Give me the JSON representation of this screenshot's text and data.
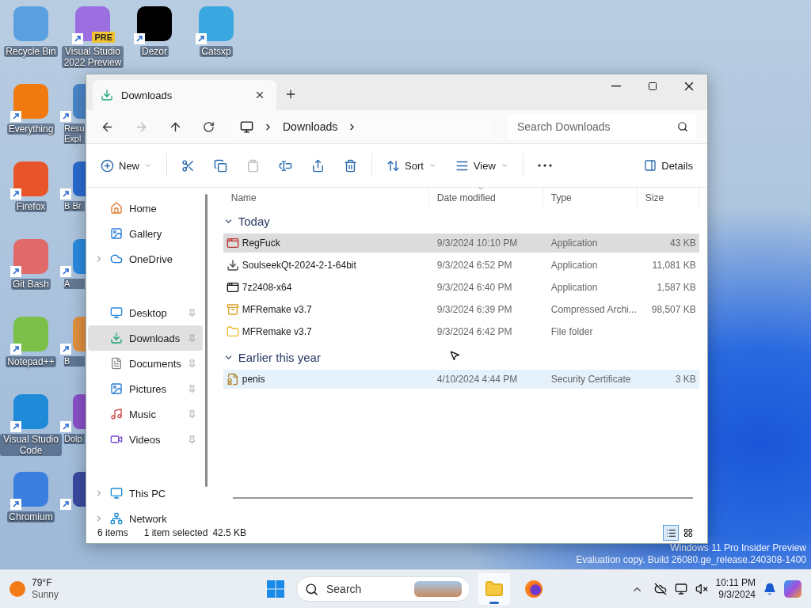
{
  "desktop": {
    "columns": [
      [
        {
          "label": "Recycle Bin",
          "kind": "full",
          "shortcut": false,
          "color": "#5aa0e0"
        },
        {
          "label": "Everything",
          "kind": "full",
          "shortcut": true,
          "color": "#f07a10"
        },
        {
          "label": "Firefox",
          "kind": "full",
          "shortcut": true,
          "color": "#e8552a"
        },
        {
          "label": "Git Bash",
          "kind": "full",
          "shortcut": true,
          "color": "#e06a6a"
        },
        {
          "label": "Notepad++",
          "kind": "full",
          "shortcut": true,
          "color": "#7cc04a"
        },
        {
          "label": "Visual Studio Code",
          "kind": "full",
          "shortcut": true,
          "color": "#1f8ad8"
        },
        {
          "label": "Chromium",
          "kind": "full",
          "shortcut": true,
          "color": "#3a7ee0"
        }
      ],
      [
        {
          "label": "Visual Studio 2022 Preview",
          "kind": "full",
          "shortcut": true,
          "color": "#9b6fe0",
          "badge": "PRE"
        },
        {
          "label": "Resu Expl",
          "kind": "partial",
          "shortcut": true,
          "color": "#4a86c8"
        },
        {
          "label": "B Br",
          "kind": "partial",
          "shortcut": true,
          "color": "#2a6ad0"
        },
        {
          "label": "A",
          "kind": "partial",
          "shortcut": true,
          "color": "#2a8ae0"
        },
        {
          "label": "B",
          "kind": "partial",
          "shortcut": true,
          "color": "#e09040"
        },
        {
          "label": "Dolp",
          "kind": "partial",
          "shortcut": true,
          "color": "#8a50c8"
        },
        {
          "kind": "partial",
          "shortcut": true,
          "color": "#3a4aa0"
        }
      ],
      [
        {
          "label": "Dezor",
          "kind": "full",
          "shortcut": true,
          "color": "#000000"
        }
      ],
      [
        {
          "label": "Catsxp",
          "kind": "full",
          "shortcut": true,
          "color": "#3aa8e0"
        }
      ]
    ]
  },
  "watermark": [
    "Windows 11 Pro Insider Preview",
    "Evaluation copy. Build 26080.ge_release.240308-1400"
  ],
  "window": {
    "tabs": [
      {
        "label": "Downloads",
        "selected": true
      }
    ],
    "address": {
      "crumbs": [
        "Downloads"
      ]
    },
    "search": {
      "placeholder": "Search Downloads"
    },
    "commands": [
      {
        "kind": "new",
        "label": "New",
        "dropdown": true,
        "disabled": false
      },
      {
        "kind": "cut",
        "disabled": false
      },
      {
        "kind": "copy",
        "disabled": false
      },
      {
        "kind": "paste",
        "disabled": true
      },
      {
        "kind": "rename",
        "disabled": false
      },
      {
        "kind": "share",
        "disabled": false
      },
      {
        "kind": "delete",
        "disabled": false
      },
      {
        "kind": "sort",
        "label": "Sort",
        "dropdown": true,
        "disabled": false
      },
      {
        "kind": "view",
        "label": "View",
        "dropdown": true,
        "disabled": false
      },
      {
        "kind": "more",
        "disabled": false
      }
    ],
    "details_button": "Details",
    "sidebar": {
      "groups": [
        [
          {
            "label": "Home",
            "expandable": false,
            "pinned": false,
            "selected": false
          },
          {
            "label": "Gallery",
            "expandable": false,
            "pinned": false,
            "selected": false
          },
          {
            "label": "OneDrive",
            "expandable": true,
            "pinned": false,
            "selected": false
          }
        ],
        [
          {
            "label": "Desktop",
            "expandable": false,
            "pinned": true,
            "selected": false
          },
          {
            "label": "Downloads",
            "expandable": false,
            "pinned": true,
            "selected": true
          },
          {
            "label": "Documents",
            "expandable": false,
            "pinned": true,
            "selected": false
          },
          {
            "label": "Pictures",
            "expandable": false,
            "pinned": true,
            "selected": false
          },
          {
            "label": "Music",
            "expandable": false,
            "pinned": true,
            "selected": false
          },
          {
            "label": "Videos",
            "expandable": false,
            "pinned": true,
            "selected": false
          }
        ],
        [
          {
            "label": "This PC",
            "expandable": true,
            "pinned": false,
            "selected": false
          },
          {
            "label": "Network",
            "expandable": true,
            "pinned": false,
            "selected": false
          }
        ]
      ]
    },
    "columns": [
      {
        "label": "Name",
        "sorted": false
      },
      {
        "label": "Date modified",
        "sorted": true
      },
      {
        "label": "Type",
        "sorted": false
      },
      {
        "label": "Size",
        "sorted": false
      }
    ],
    "groups": [
      {
        "label": "Today",
        "expanded": true,
        "files": [
          {
            "name": "RegFuck",
            "kind": "app",
            "date": "9/3/2024 10:10 PM",
            "type": "Application",
            "size": "43 KB",
            "selected": true,
            "hovered": false
          },
          {
            "name": "SoulseekQt-2024-2-1-64bit",
            "kind": "installer",
            "date": "9/3/2024 6:52 PM",
            "type": "Application",
            "size": "11,081 KB",
            "selected": false,
            "hovered": false
          },
          {
            "name": "7z2408-x64",
            "kind": "sevenzip",
            "date": "9/3/2024 6:40 PM",
            "type": "Application",
            "size": "1,587 KB",
            "selected": false,
            "hovered": false
          },
          {
            "name": "MFRemake v3.7",
            "kind": "archive",
            "date": "9/3/2024 6:39 PM",
            "type": "Compressed Archi...",
            "size": "98,507 KB",
            "selected": false,
            "hovered": false
          },
          {
            "name": "MFRemake v3.7",
            "kind": "folder",
            "date": "9/3/2024 6:42 PM",
            "type": "File folder",
            "selected": false,
            "hovered": false
          }
        ]
      },
      {
        "label": "Earlier this year",
        "expanded": true,
        "files": [
          {
            "name": "penis",
            "kind": "certificate",
            "date": "4/10/2024 4:44 PM",
            "type": "Security Certificate",
            "size": "3 KB",
            "selected": false,
            "hovered": true
          }
        ]
      }
    ],
    "status": {
      "count": "6 items",
      "selection": "1 item selected",
      "size": "42.5 KB",
      "views": [
        {
          "kind": "details",
          "selected": true
        },
        {
          "kind": "tiles",
          "selected": false
        }
      ]
    }
  },
  "taskbar": {
    "weather": {
      "temp": "79°F",
      "condition": "Sunny"
    },
    "search": {
      "placeholder": "Search"
    },
    "apps": [
      {
        "kind": "explorer",
        "active": true
      },
      {
        "kind": "firefox",
        "active": false
      }
    ],
    "time": "10:11 PM",
    "date": "9/3/2024"
  }
}
